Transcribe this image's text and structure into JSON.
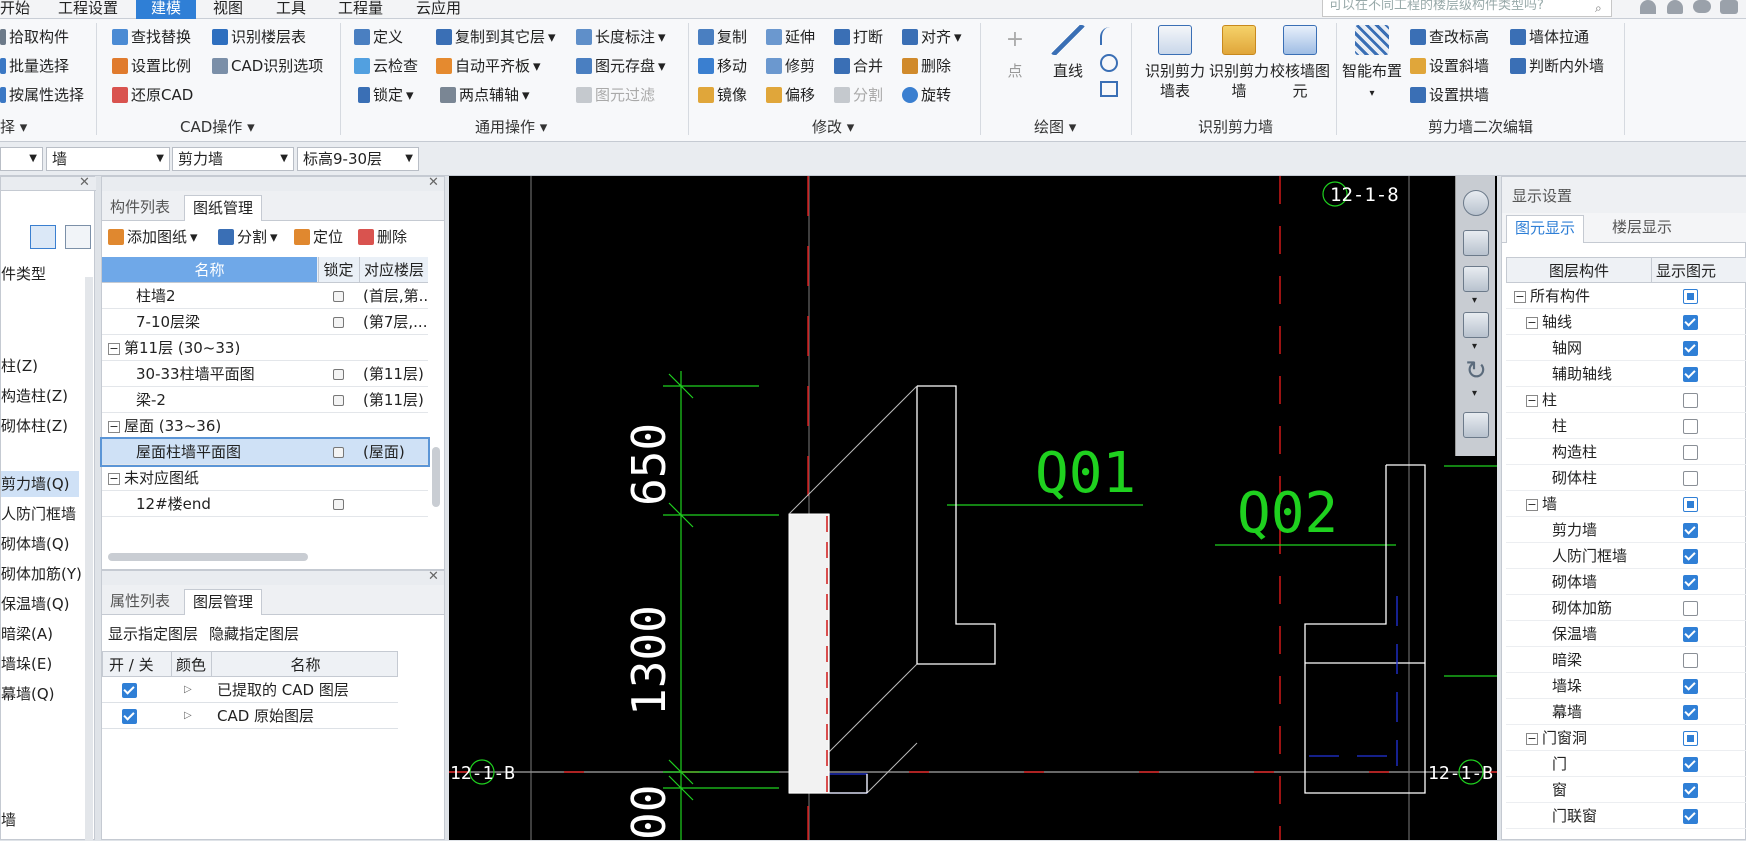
{
  "menubar": {
    "tabs": [
      {
        "label": "开始",
        "active": false
      },
      {
        "label": "工程设置",
        "active": false
      },
      {
        "label": "建模",
        "active": true
      },
      {
        "label": "视图",
        "active": false
      },
      {
        "label": "工具",
        "active": false
      },
      {
        "label": "工程量",
        "active": false
      },
      {
        "label": "云应用",
        "active": false
      }
    ],
    "search_placeholder": "可以在不同工程的楼层级构件类型吗?"
  },
  "ribbon": {
    "select_group": {
      "items": [
        "拾取构件",
        "批量选择",
        "按属性选择"
      ],
      "label": "择"
    },
    "cad_group": {
      "items": [
        "查找替换",
        "识别楼层表",
        "设置比例",
        "CAD识别选项",
        "还原CAD"
      ],
      "label": "CAD操作"
    },
    "common_group": {
      "items": [
        "定义",
        "复制到其它层",
        "长度标注",
        "云检查",
        "自动平齐板",
        "图元存盘",
        "锁定",
        "两点辅轴",
        "图元过滤"
      ],
      "label": "通用操作"
    },
    "modify_group": {
      "items": [
        "复制",
        "延伸",
        "打断",
        "对齐",
        "移动",
        "修剪",
        "合并",
        "删除",
        "镜像",
        "偏移",
        "分割",
        "旋转"
      ],
      "label": "修改"
    },
    "draw_group": {
      "items": [
        "点",
        "直线"
      ],
      "label": "绘图"
    },
    "recognize_group": {
      "items": [
        "识别剪力墙表",
        "识别剪力墙",
        "校核墙图元"
      ],
      "label": "识别剪力墙"
    },
    "secondary_group": {
      "items": [
        "智能布置",
        "查改标高",
        "墙体拉通",
        "设置斜墙",
        "判断内外墙",
        "设置拱墙"
      ],
      "label": "剪力墙二次编辑"
    }
  },
  "selectors": {
    "first": "",
    "category": "墙",
    "type": "剪力墙",
    "floor": "标高9-30层"
  },
  "left_panel": {
    "header": "件类型",
    "items": [
      "柱(Z)",
      "构造柱(Z)",
      "砌体柱(Z)",
      "剪力墙(Q)",
      "人防门框墙",
      "砌体墙(Q)",
      "砌体加筋(Y)",
      "保温墙(Q)",
      "暗梁(A)",
      "墙垛(E)",
      "幕墙(Q)"
    ],
    "bottom": "墙"
  },
  "drawing_panel": {
    "tabs": [
      "构件列表",
      "图纸管理"
    ],
    "toolbar": [
      "添加图纸",
      "分割",
      "定位",
      "删除"
    ],
    "columns": [
      "名称",
      "锁定",
      "对应楼层"
    ],
    "rows": [
      {
        "name": "柱墙2",
        "floor": "(首层,第..",
        "group": false
      },
      {
        "name": "7-10层梁",
        "floor": "(第7层,...",
        "group": false
      },
      {
        "name": "第11层 (30~33)",
        "floor": "",
        "group": true
      },
      {
        "name": "30-33柱墙平面图",
        "floor": "(第11层)",
        "group": false
      },
      {
        "name": "梁-2",
        "floor": "(第11层)",
        "group": false
      },
      {
        "name": "屋面 (33~36)",
        "floor": "",
        "group": true
      },
      {
        "name": "屋面柱墙平面图",
        "floor": "(屋面)",
        "group": false,
        "selected": true
      },
      {
        "name": "未对应图纸",
        "floor": "",
        "group": true
      },
      {
        "name": "12#楼end",
        "floor": "",
        "group": false
      }
    ]
  },
  "layer_panel": {
    "tabs": [
      "属性列表",
      "图层管理"
    ],
    "actions": [
      "显示指定图层",
      "隐藏指定图层"
    ],
    "columns": [
      "开 / 关",
      "颜色",
      "名称"
    ],
    "rows": [
      {
        "name": "已提取的 CAD 图层",
        "on": true
      },
      {
        "name": "CAD 原始图层",
        "on": true
      }
    ]
  },
  "canvas": {
    "labels": {
      "axis_top": "12-1-8",
      "axis_left": "12-1-B",
      "axis_right": "12-1-B",
      "wall1": "Q01",
      "wall2": "Q02",
      "dim1": "650",
      "dim2": "1300",
      "dim3": "00"
    }
  },
  "display_panel": {
    "title": "显示设置",
    "tabs": [
      "图元显示",
      "楼层显示"
    ],
    "columns": [
      "图层构件",
      "显示图元"
    ],
    "rows": [
      {
        "label": "所有构件",
        "level": 0,
        "expander": true,
        "state": "part"
      },
      {
        "label": "轴线",
        "level": 1,
        "expander": true,
        "state": "on"
      },
      {
        "label": "轴网",
        "level": 2,
        "expander": false,
        "state": "on"
      },
      {
        "label": "辅助轴线",
        "level": 2,
        "expander": false,
        "state": "on"
      },
      {
        "label": "柱",
        "level": 1,
        "expander": true,
        "state": "off"
      },
      {
        "label": "柱",
        "level": 2,
        "expander": false,
        "state": "off"
      },
      {
        "label": "构造柱",
        "level": 2,
        "expander": false,
        "state": "off"
      },
      {
        "label": "砌体柱",
        "level": 2,
        "expander": false,
        "state": "off"
      },
      {
        "label": "墙",
        "level": 1,
        "expander": true,
        "state": "part"
      },
      {
        "label": "剪力墙",
        "level": 2,
        "expander": false,
        "state": "on"
      },
      {
        "label": "人防门框墙",
        "level": 2,
        "expander": false,
        "state": "on"
      },
      {
        "label": "砌体墙",
        "level": 2,
        "expander": false,
        "state": "on"
      },
      {
        "label": "砌体加筋",
        "level": 2,
        "expander": false,
        "state": "off"
      },
      {
        "label": "保温墙",
        "level": 2,
        "expander": false,
        "state": "on"
      },
      {
        "label": "暗梁",
        "level": 2,
        "expander": false,
        "state": "off"
      },
      {
        "label": "墙垛",
        "level": 2,
        "expander": false,
        "state": "on"
      },
      {
        "label": "幕墙",
        "level": 2,
        "expander": false,
        "state": "on"
      },
      {
        "label": "门窗洞",
        "level": 1,
        "expander": true,
        "state": "part"
      },
      {
        "label": "门",
        "level": 2,
        "expander": false,
        "state": "on"
      },
      {
        "label": "窗",
        "level": 2,
        "expander": false,
        "state": "on"
      },
      {
        "label": "门联窗",
        "level": 2,
        "expander": false,
        "state": "on"
      }
    ]
  }
}
